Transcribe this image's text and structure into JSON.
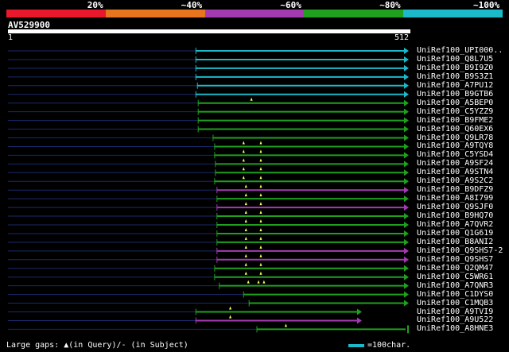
{
  "legend": {
    "segments": [
      {
        "color": "#e8192c",
        "label": "20%"
      },
      {
        "color": "#e8761e",
        "label": "~40%"
      },
      {
        "color": "#a23bb0",
        "label": "~60%"
      },
      {
        "color": "#1fa01f",
        "label": "~80%"
      },
      {
        "color": "#1bb9c9",
        "label": "~100%"
      }
    ]
  },
  "query": {
    "name": "AV529900",
    "start_label": "1",
    "end_label": "512",
    "length": 512
  },
  "colors": {
    "faded": "#1a2a6a",
    "cyan": "#1bb9c9",
    "green": "#1fa01f",
    "purple": "#a23bb0",
    "marker": "#ffff66"
  },
  "hits": [
    {
      "name": "UniRef100_UPI000..",
      "color": "cyan",
      "start": 240,
      "end": 512,
      "head": "arrow",
      "markers": []
    },
    {
      "name": "UniRef100_Q8L7U5",
      "color": "cyan",
      "start": 240,
      "end": 512,
      "head": "arrow",
      "markers": []
    },
    {
      "name": "UniRef100_B9I9Z0",
      "color": "cyan",
      "start": 240,
      "end": 512,
      "head": "arrow",
      "markers": []
    },
    {
      "name": "UniRef100_B9S3Z1",
      "color": "cyan",
      "start": 240,
      "end": 512,
      "head": "arrow",
      "markers": []
    },
    {
      "name": "UniRef100_A7PU12",
      "color": "cyan",
      "start": 242,
      "end": 512,
      "head": "arrow",
      "markers": []
    },
    {
      "name": "UniRef100_B9GTB6",
      "color": "cyan",
      "start": 240,
      "end": 512,
      "head": "arrow",
      "markers": []
    },
    {
      "name": "UniRef100_A5BEP0",
      "color": "green",
      "start": 243,
      "end": 512,
      "head": "arrow",
      "markers": [
        311
      ]
    },
    {
      "name": "UniRef100_C5YZZ9",
      "color": "green",
      "start": 243,
      "end": 512,
      "head": "arrow",
      "markers": []
    },
    {
      "name": "UniRef100_B9FME2",
      "color": "green",
      "start": 243,
      "end": 512,
      "head": "arrow",
      "markers": []
    },
    {
      "name": "UniRef100_Q60EX6",
      "color": "green",
      "start": 243,
      "end": 512,
      "head": "arrow",
      "markers": []
    },
    {
      "name": "UniRef100_Q9LR78",
      "color": "green",
      "start": 262,
      "end": 512,
      "head": "arrow",
      "markers": []
    },
    {
      "name": "UniRef100_A9TQY8",
      "color": "green",
      "start": 264,
      "end": 512,
      "head": "arrow",
      "markers": [
        301,
        323
      ]
    },
    {
      "name": "UniRef100_C5YSD4",
      "color": "green",
      "start": 264,
      "end": 512,
      "head": "arrow",
      "markers": [
        301,
        323
      ]
    },
    {
      "name": "UniRef100_A9SF24",
      "color": "green",
      "start": 265,
      "end": 512,
      "head": "arrow",
      "markers": [
        301,
        323
      ]
    },
    {
      "name": "UniRef100_A9STN4",
      "color": "green",
      "start": 265,
      "end": 512,
      "head": "arrow",
      "markers": [
        301,
        323
      ]
    },
    {
      "name": "UniRef100_A9S2C2",
      "color": "green",
      "start": 264,
      "end": 512,
      "head": "arrow",
      "markers": [
        301,
        323
      ]
    },
    {
      "name": "UniRef100_B9DFZ9",
      "color": "purple",
      "start": 267,
      "end": 512,
      "head": "arrow",
      "markers": [
        304,
        323
      ]
    },
    {
      "name": "UniRef100_A8I799",
      "color": "green",
      "start": 267,
      "end": 512,
      "head": "arrow",
      "markers": [
        304,
        323
      ]
    },
    {
      "name": "UniRef100_Q9SJF0",
      "color": "purple",
      "start": 267,
      "end": 512,
      "head": "arrow",
      "markers": [
        304,
        323
      ]
    },
    {
      "name": "UniRef100_B9HQ70",
      "color": "green",
      "start": 267,
      "end": 512,
      "head": "arrow",
      "markers": [
        304,
        323
      ]
    },
    {
      "name": "UniRef100_A7QVR2",
      "color": "green",
      "start": 267,
      "end": 512,
      "head": "arrow",
      "markers": [
        304,
        323
      ]
    },
    {
      "name": "UniRef100_Q1G619",
      "color": "green",
      "start": 267,
      "end": 512,
      "head": "arrow",
      "markers": [
        304,
        323
      ]
    },
    {
      "name": "UniRef100_B8ANI2",
      "color": "green",
      "start": 267,
      "end": 512,
      "head": "arrow",
      "markers": [
        304,
        323
      ]
    },
    {
      "name": "UniRef100_Q9SHS7-2",
      "color": "purple",
      "start": 267,
      "end": 512,
      "head": "arrow",
      "markers": [
        304,
        323
      ]
    },
    {
      "name": "UniRef100_Q9SHS7",
      "color": "purple",
      "start": 267,
      "end": 512,
      "head": "arrow",
      "markers": [
        304,
        323
      ]
    },
    {
      "name": "UniRef100_Q2QM47",
      "color": "green",
      "start": 264,
      "end": 512,
      "head": "arrow",
      "markers": [
        304,
        323
      ]
    },
    {
      "name": "UniRef100_C5WR61",
      "color": "green",
      "start": 264,
      "end": 512,
      "head": "arrow",
      "markers": [
        304,
        323
      ]
    },
    {
      "name": "UniRef100_A7QNR3",
      "color": "green",
      "start": 270,
      "end": 512,
      "head": "arrow",
      "markers": [
        307,
        320,
        327
      ]
    },
    {
      "name": "UniRef100_C1DYS0",
      "color": "green",
      "start": 301,
      "end": 512,
      "head": "arrow",
      "markers": []
    },
    {
      "name": "UniRef100_C1MQB3",
      "color": "green",
      "start": 308,
      "end": 512,
      "head": "arrow",
      "markers": []
    },
    {
      "name": "UniRef100_A9TVI9",
      "color": "green",
      "start": 240,
      "end": 452,
      "head": "arrow",
      "markers": [
        284
      ]
    },
    {
      "name": "UniRef100_A9U522",
      "color": "purple",
      "start": 240,
      "end": 452,
      "head": "arrow",
      "markers": [
        284
      ]
    },
    {
      "name": "UniRef100_A8HNE3",
      "color": "green",
      "start": 318,
      "end": 512,
      "head": "bar",
      "markers": [
        355
      ]
    }
  ],
  "footer": {
    "gaps_text": "Large gaps: ▲(in Query)/- (in Subject)",
    "scale_text": "=100char."
  }
}
